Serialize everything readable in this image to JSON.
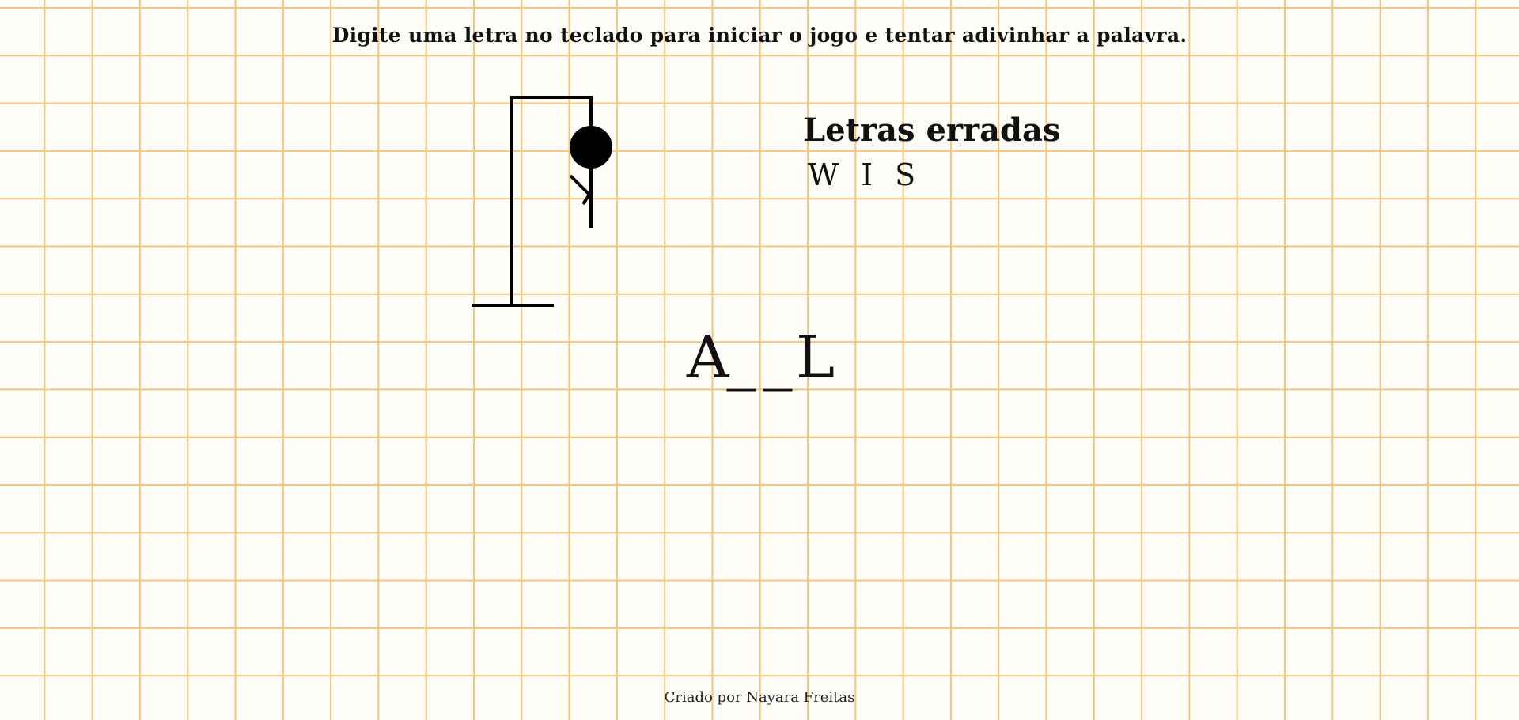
{
  "instructions": "Digite uma letra no teclado para iniciar o jogo e tentar adivinhar a palavra.",
  "wrong_letters": {
    "title": "Letras erradas",
    "letters": [
      "W",
      "I",
      "S"
    ]
  },
  "word": {
    "slots": [
      "A",
      "_",
      "_",
      "L"
    ]
  },
  "hangman": {
    "parts_shown": [
      "head",
      "body",
      "left-arm"
    ]
  },
  "footer": "Criado por Nayara Freitas",
  "colors": {
    "grid": "#f4c57c",
    "background": "#fffdf8",
    "ink": "#000000"
  }
}
